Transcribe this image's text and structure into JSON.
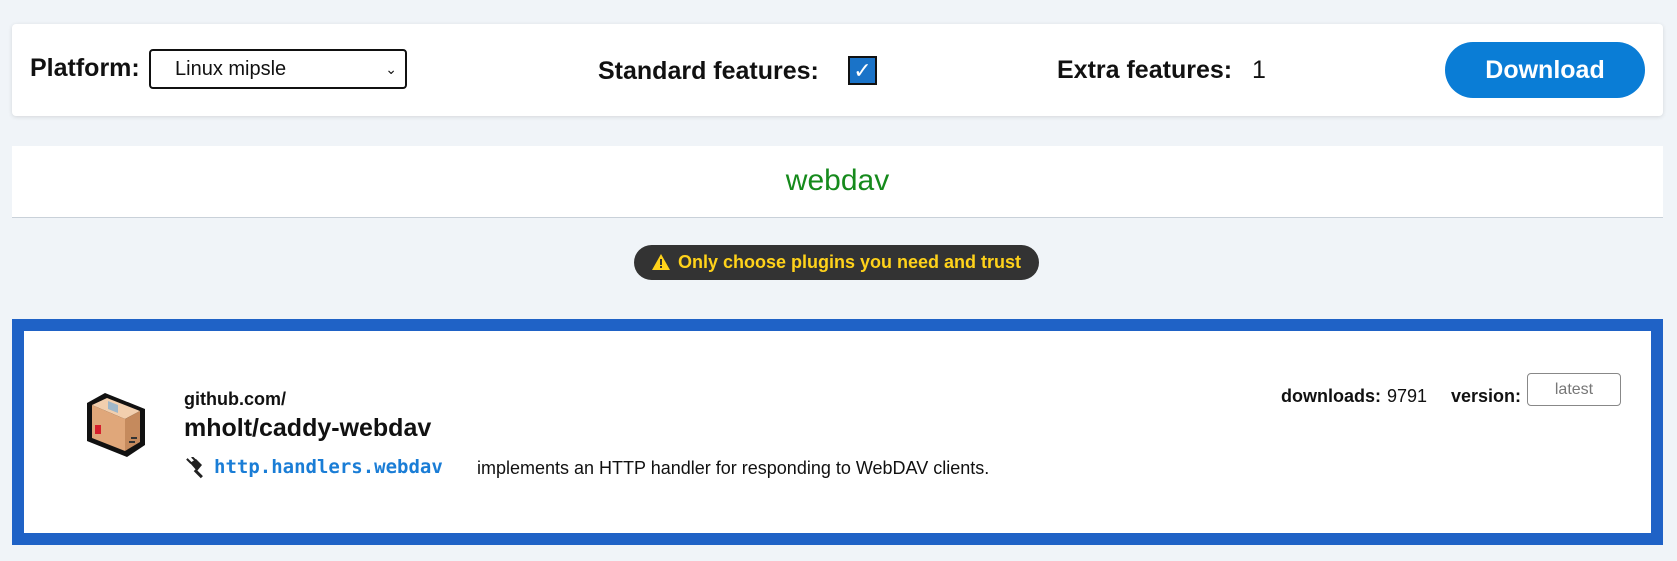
{
  "toolbar": {
    "platform_label": "Platform:",
    "platform_value": "Linux mipsle",
    "standard_features_label": "Standard features:",
    "standard_features_checked": true,
    "extra_features_label": "Extra features:",
    "extra_features_value": "1",
    "download_label": "Download"
  },
  "search": {
    "value": "webdav"
  },
  "warning": {
    "text": "Only choose plugins you need and trust"
  },
  "plugin": {
    "repo_prefix": "github.com/",
    "repo_name": "mholt/caddy-webdav",
    "module": "http.handlers.webdav",
    "description": "implements an HTTP handler for responding to WebDAV clients.",
    "downloads_label": "downloads:",
    "downloads_value": "9791",
    "version_label": "version:",
    "version_placeholder": "latest"
  },
  "colors": {
    "accent": "#0a7dd6",
    "card_border": "#1f62c6",
    "search_text": "#168a1c",
    "warning_text": "#ffd21a"
  },
  "icons": {
    "package": "package-box-icon",
    "plug": "plug-icon",
    "warning": "warning-triangle-icon"
  }
}
